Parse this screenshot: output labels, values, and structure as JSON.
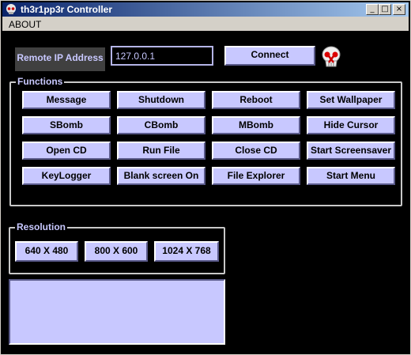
{
  "window": {
    "title": "th3r1pp3r Controller",
    "controls": {
      "minimize": "_",
      "maximize": "□",
      "close": "×"
    }
  },
  "menu": {
    "about": "ABOUT"
  },
  "connection": {
    "ip_label": "Remote IP Address",
    "ip_value": "127.0.0.1",
    "connect_label": "Connect"
  },
  "functions": {
    "group_label": "Functions",
    "buttons": [
      "Message",
      "Shutdown",
      "Reboot",
      "Set Wallpaper",
      "SBomb",
      "CBomb",
      "MBomb",
      "Hide Cursor",
      "Open CD",
      "Run File",
      "Close CD",
      "Start Screensaver",
      "KeyLogger",
      "Blank screen On",
      "File Explorer",
      "Start Menu"
    ]
  },
  "resolution": {
    "group_label": "Resolution",
    "buttons": [
      "640 X 480",
      "800 X 600",
      "1024 X 768"
    ]
  },
  "output": {
    "text": ""
  },
  "colors": {
    "background": "#000000",
    "button_face": "#c8c8ff",
    "label_text": "#c8c8ff",
    "titlebar_start": "#0a246a",
    "titlebar_end": "#a6caf0"
  },
  "icons": {
    "app": "skull-icon",
    "logo": "skull-logo-icon"
  }
}
